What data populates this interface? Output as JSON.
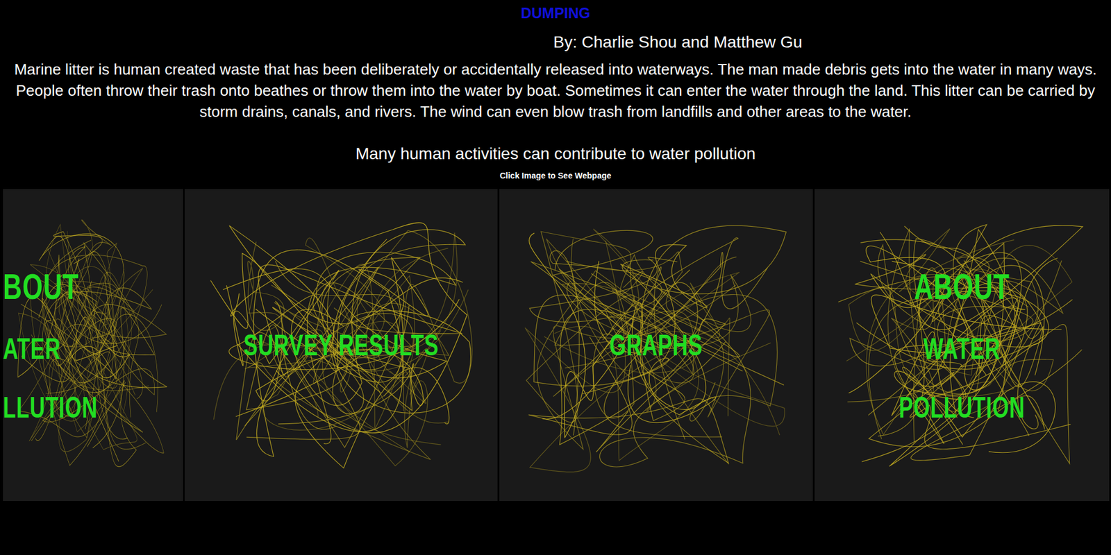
{
  "title": "DUMPING",
  "byline": "By: Charlie Shou and Matthew Gu",
  "paragraph": "Marine litter is human created waste that has been deliberately or accidentally released into waterways. The man made debris gets into the water in many ways. People often throw their trash onto beathes or throw them into the water by boat. Sometimes it can enter the water through the land. This litter can be carried by storm drains, canals, and rivers. The wind can even blow trash from landfills and other areas to the water.",
  "subheading": "Many human activities can contribute to water pollution",
  "hint": "Click Image to See Webpage",
  "panels": [
    {
      "lines": [
        "BOUT",
        "ATER",
        "LLUTION"
      ],
      "kind": "cut"
    },
    {
      "lines": [
        "SURVEY RESULTS"
      ],
      "kind": "full"
    },
    {
      "lines": [
        "GRAPHS"
      ],
      "kind": "full"
    },
    {
      "lines": [
        "ABOUT",
        "WATER",
        "POLLUTION"
      ],
      "kind": "full"
    }
  ]
}
